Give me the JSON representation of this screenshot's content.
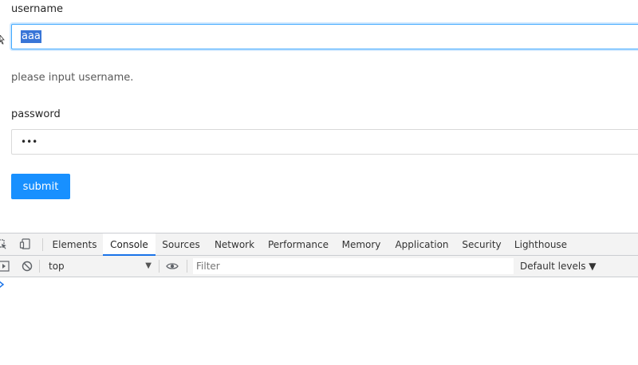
{
  "form": {
    "username_label": "username",
    "username_value": "aaa",
    "help_text": "please input username.",
    "password_label": "password",
    "password_masked": "•••",
    "submit_label": "submit"
  },
  "devtools": {
    "tabs": [
      {
        "label": "Elements",
        "active": false
      },
      {
        "label": "Console",
        "active": true
      },
      {
        "label": "Sources",
        "active": false
      },
      {
        "label": "Network",
        "active": false
      },
      {
        "label": "Performance",
        "active": false
      },
      {
        "label": "Memory",
        "active": false
      },
      {
        "label": "Application",
        "active": false
      },
      {
        "label": "Security",
        "active": false
      },
      {
        "label": "Lighthouse",
        "active": false
      }
    ],
    "context": "top",
    "filter_placeholder": "Filter",
    "levels_label": "Default levels ▼"
  },
  "colors": {
    "primary": "#1890ff",
    "focus_border": "#40a9ff",
    "selection": "#3875d7",
    "devtools_accent": "#1a73e8"
  }
}
